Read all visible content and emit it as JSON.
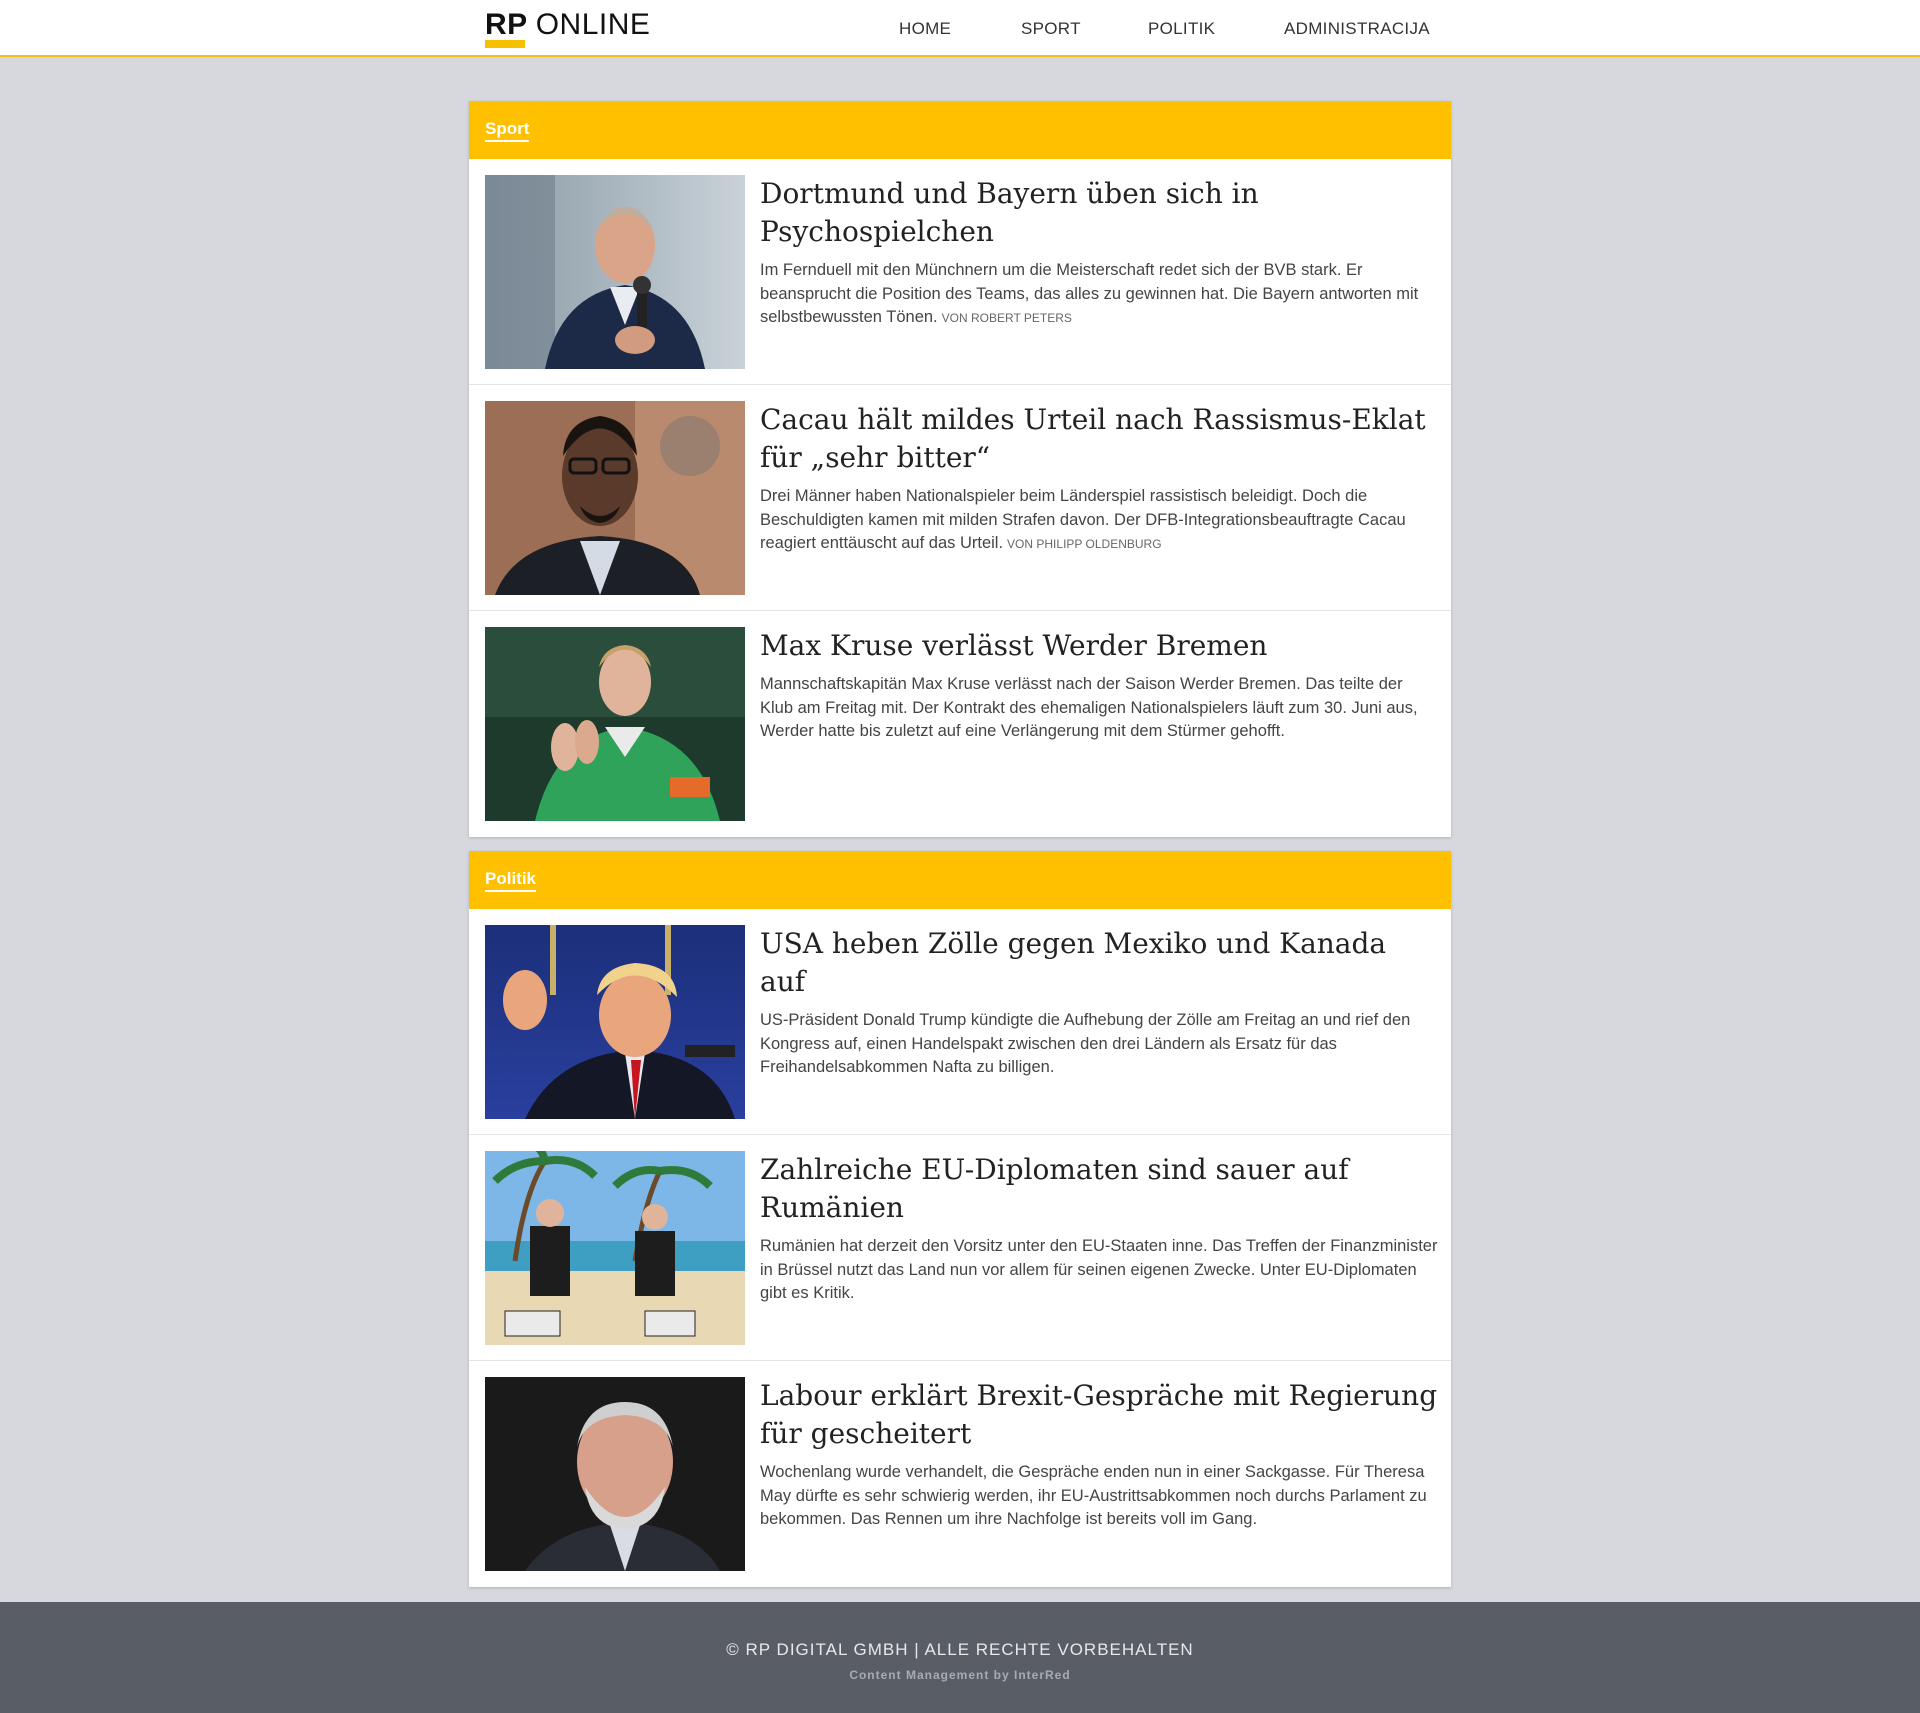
{
  "brand": {
    "logo_rp": "RP",
    "logo_online": "ONLINE",
    "accent_color": "#ffc000"
  },
  "nav": {
    "items": [
      {
        "label": "HOME"
      },
      {
        "label": "SPORT"
      },
      {
        "label": "POLITIK"
      },
      {
        "label": "ADMINISTRACIJA"
      }
    ]
  },
  "sections": [
    {
      "title": "Sport",
      "articles": [
        {
          "headline": "Dortmund und Bayern üben sich in Psychospielchen",
          "teaser": "Im Fernduell mit den Münchnern um die Meisterschaft redet sich der BVB stark. Er beansprucht die Position des Teams, das alles zu gewinnen hat. Die Bayern antworten mit selbstbewussten Tönen.",
          "byline": "von Robert Peters",
          "image": "man-with-microphone-photo"
        },
        {
          "headline": "Cacau hält mildes Urteil nach Rassismus-Eklat für „sehr bitter“",
          "teaser": "Drei Männer haben Nationalspieler beim Länderspiel rassistisch beleidigt. Doch die Beschuldigten kamen mit milden Strafen davon. Der DFB-Integrationsbeauftragte Cacau reagiert enttäuscht auf das Urteil.",
          "byline": "von Philipp Oldenburg",
          "image": "man-with-glasses-photo"
        },
        {
          "headline": "Max Kruse verlässt Werder Bremen",
          "teaser": "Mannschaftskapitän Max Kruse verlässt nach der Saison Werder Bremen. Das teilte der Klub am Freitag mit. Der Kontrakt des ehemaligen Nationalspielers läuft zum 30. Juni aus, Werder hatte bis zuletzt auf eine Verlängerung mit dem Stürmer gehofft.",
          "byline": "",
          "image": "football-player-clapping-photo"
        }
      ]
    },
    {
      "title": "Politik",
      "articles": [
        {
          "headline": "USA heben Zölle gegen Mexiko und Kanada auf",
          "teaser": "US-Präsident Donald Trump kündigte die Aufhebung der Zölle am Freitag an und rief den Kongress auf, einen Handelspakt zwischen den drei Ländern als Ersatz für das Freihandelsabkommen Nafta zu billigen.",
          "byline": "",
          "image": "politician-speaking-photo"
        },
        {
          "headline": "Zahlreiche EU-Diplomaten sind sauer auf Rumänien",
          "teaser": "Rumänien hat derzeit den Vorsitz unter den EU-Staaten inne. Das Treffen der Finanzminister in Brüssel nutzt das Land nun vor allem für seinen eigenen Zwecke. Unter EU-Diplomaten gibt es Kritik.",
          "byline": "",
          "image": "beach-protest-photo"
        },
        {
          "headline": "Labour erklärt Brexit-Gespräche mit Regierung für gescheitert",
          "teaser": "Wochenlang wurde verhandelt, die Gespräche enden nun in einer Sackgasse. Für Theresa May dürfte es sehr schwierig werden, ihr EU-Austrittsabkommen noch durchs Parlament zu bekommen. Das Rennen um ihre Nachfolge ist bereits voll im Gang.",
          "byline": "",
          "image": "older-man-portrait-photo"
        }
      ]
    }
  ],
  "footer": {
    "copyright": "© RP DIGITAL GMBH | ALLE RECHTE VORBEHALTEN",
    "cms": "Content Management by InterRed"
  }
}
